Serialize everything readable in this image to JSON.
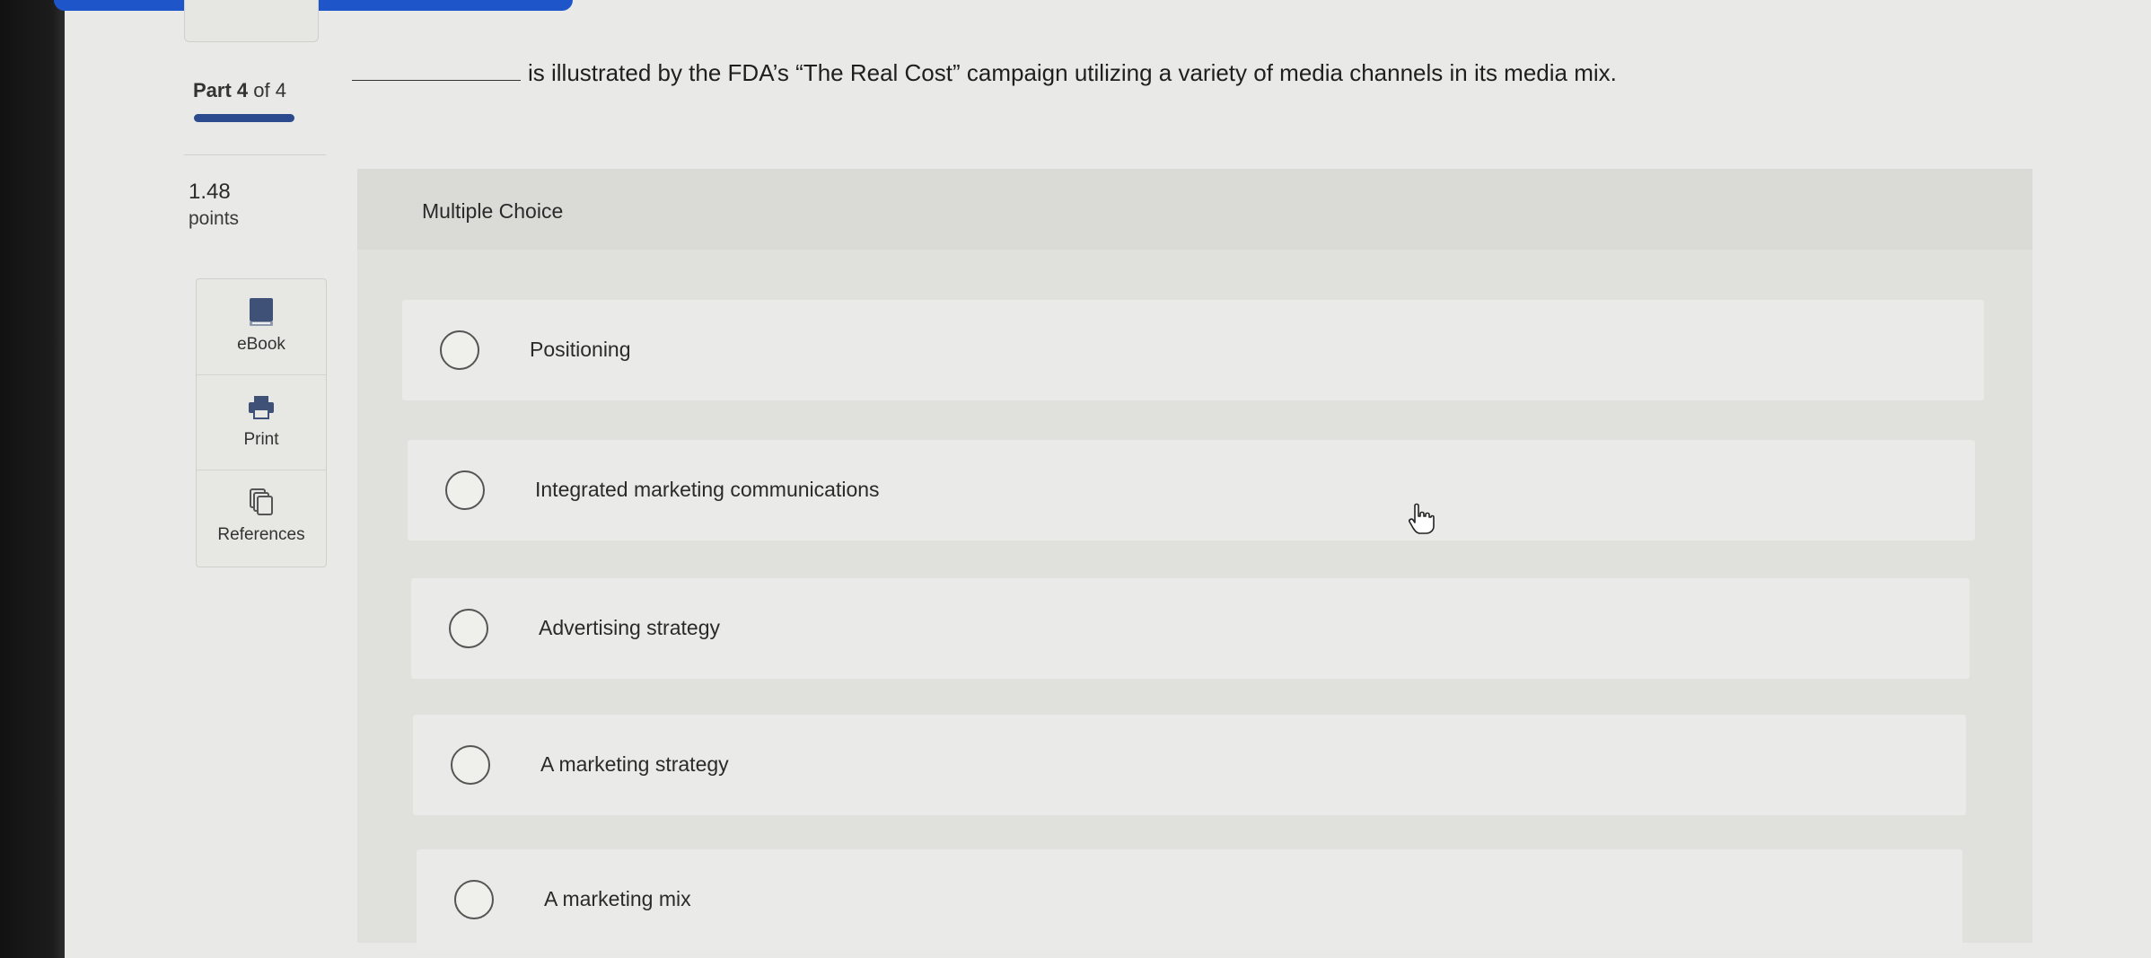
{
  "header": {
    "part_label": "Part 4",
    "part_of": "of 4"
  },
  "points": {
    "value": "1.48",
    "label": "points"
  },
  "tools": [
    {
      "label": "eBook",
      "icon": "ebook-icon"
    },
    {
      "label": "Print",
      "icon": "printer-icon"
    },
    {
      "label": "References",
      "icon": "references-icon"
    }
  ],
  "question": {
    "text": "is illustrated by the FDA’s “The Real Cost” campaign utilizing a variety of media channels in its media mix."
  },
  "answer_panel": {
    "type_label": "Multiple Choice",
    "choices": [
      {
        "label": "Positioning",
        "selected": false
      },
      {
        "label": "Integrated marketing communications",
        "selected": false
      },
      {
        "label": "Advertising strategy",
        "selected": false
      },
      {
        "label": "A marketing strategy",
        "selected": false
      },
      {
        "label": "A marketing mix",
        "selected": false
      }
    ]
  },
  "colors": {
    "accent": "#1e56c9",
    "progress": "#2c4a8e",
    "background": "#e9e9e7"
  }
}
